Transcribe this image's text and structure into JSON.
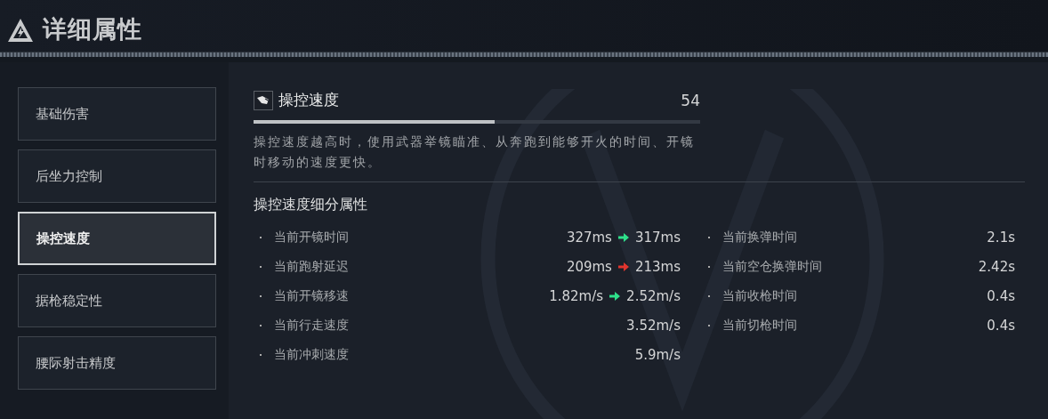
{
  "header": {
    "title": "详细属性"
  },
  "sidebar": {
    "items": [
      {
        "label": "基础伤害",
        "selected": false
      },
      {
        "label": "后坐力控制",
        "selected": false
      },
      {
        "label": "操控速度",
        "selected": true
      },
      {
        "label": "据枪稳定性",
        "selected": false
      },
      {
        "label": "腰际射击精度",
        "selected": false
      }
    ]
  },
  "stat": {
    "name": "操控速度",
    "value": "54",
    "level": 0.54,
    "description": "操控速度越高时，使用武器举镜瞄准、从奔跑到能够开火的时间、开镜时移动的速度更快。"
  },
  "details": {
    "title": "操控速度细分属性",
    "columns": [
      [
        {
          "kind": "change",
          "label": "当前开镜时间",
          "from": "327ms",
          "to": "317ms",
          "color": "#2ee08a"
        },
        {
          "kind": "change",
          "label": "当前跑射延迟",
          "from": "209ms",
          "to": "213ms",
          "color": "#e0352e"
        },
        {
          "kind": "change",
          "label": "当前开镜移速",
          "from": "1.82m/s",
          "to": "2.52m/s",
          "color": "#2ee08a"
        },
        {
          "kind": "plain",
          "label": "当前行走速度",
          "value": "3.52m/s"
        },
        {
          "kind": "plain",
          "label": "当前冲刺速度",
          "value": "5.9m/s"
        }
      ],
      [
        {
          "kind": "plain",
          "label": "当前换弹时间",
          "value": "2.1s"
        },
        {
          "kind": "plain",
          "label": "当前空仓换弹时间",
          "value": "2.42s"
        },
        {
          "kind": "plain",
          "label": "当前收枪时间",
          "value": "0.4s"
        },
        {
          "kind": "plain",
          "label": "当前切枪时间",
          "value": "0.4s"
        }
      ]
    ]
  }
}
